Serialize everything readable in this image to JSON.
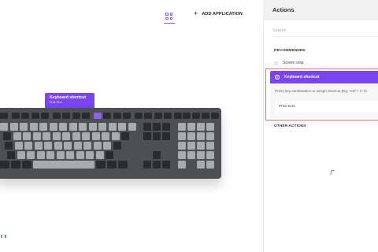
{
  "toolbar": {
    "grid_icon": "grid-icon",
    "add_application_label": "ADD APPLICATION"
  },
  "tooltip": {
    "title": "Keyboard shortcut",
    "subtitle": "Print Scrn"
  },
  "panel": {
    "title": "Actions",
    "search_placeholder": "Search",
    "recommended_label": "RECOMMENDED",
    "recommended_items": [
      {
        "label": "Screen snip"
      }
    ],
    "selected_action": "Keyboard shortcut",
    "hint": "Press key combination to assign shortcut (Eg. 'Ctrl + C' fo",
    "shortcut_value": "Print Scrn",
    "other_actions_label": "OTHER ACTIONS"
  },
  "colors": {
    "accent": "#7a44f0",
    "highlight_border": "#e07070",
    "keyboard_body": "#4e4f52",
    "key_light": "#a9abae",
    "key_dark": "#2a2b2e"
  }
}
